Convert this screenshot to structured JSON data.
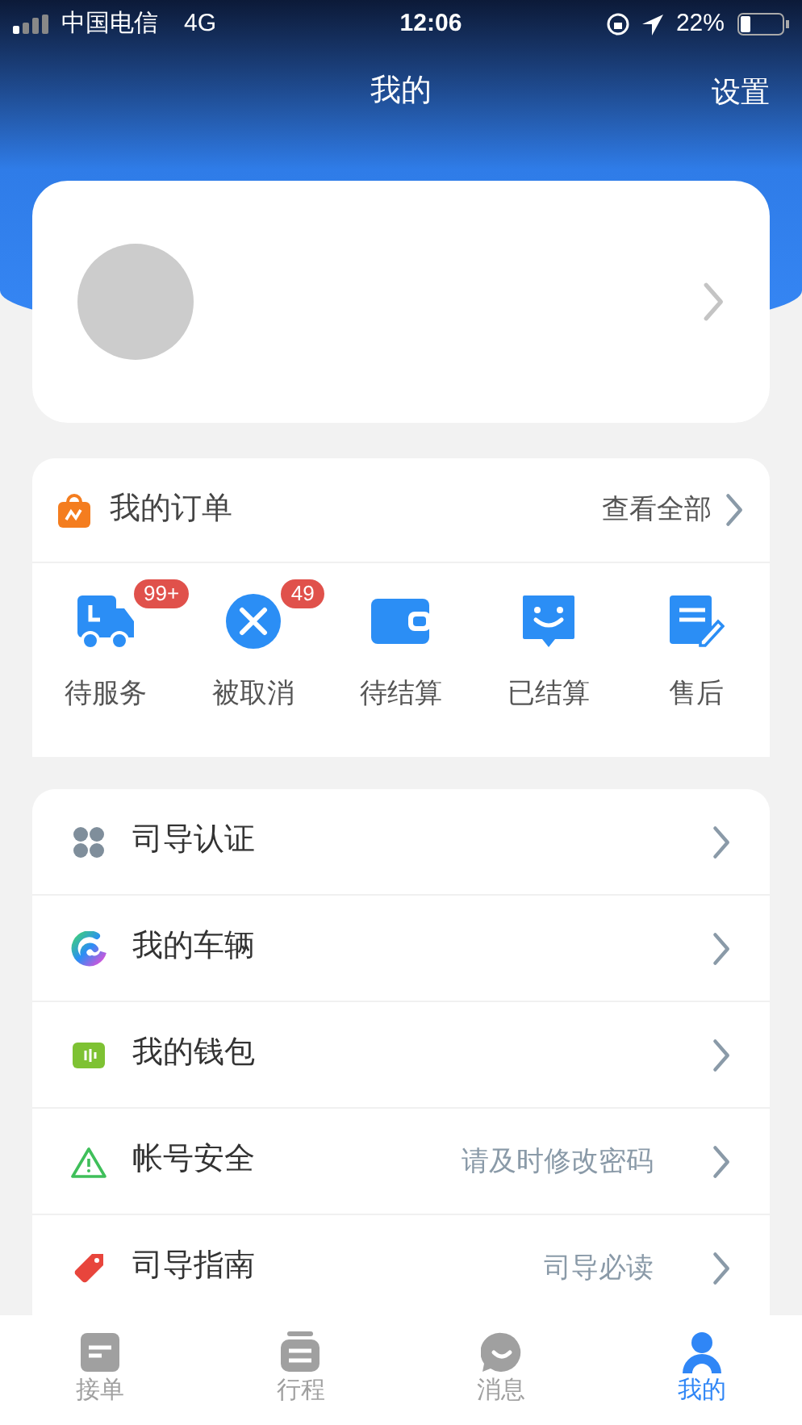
{
  "status_bar": {
    "carrier": "中国电信",
    "network": "4G",
    "time": "12:06",
    "battery": "22%"
  },
  "header": {
    "title": "我的",
    "settings": "设置"
  },
  "orders": {
    "title": "我的订单",
    "view_all": "查看全部",
    "items": [
      {
        "label": "待服务",
        "badge": "99+"
      },
      {
        "label": "被取消",
        "badge": "49"
      },
      {
        "label": "待结算"
      },
      {
        "label": "已结算"
      },
      {
        "label": "售后"
      }
    ]
  },
  "menu": [
    {
      "label": "司导认证"
    },
    {
      "label": "我的车辆"
    },
    {
      "label": "我的钱包"
    },
    {
      "label": "帐号安全",
      "hint": "请及时修改密码"
    },
    {
      "label": "司导指南",
      "hint": "司导必读"
    }
  ],
  "tab_bar": [
    {
      "label": "接单",
      "selected": false
    },
    {
      "label": "行程",
      "selected": false
    },
    {
      "label": "消息",
      "selected": false
    },
    {
      "label": "我的",
      "selected": true
    }
  ]
}
